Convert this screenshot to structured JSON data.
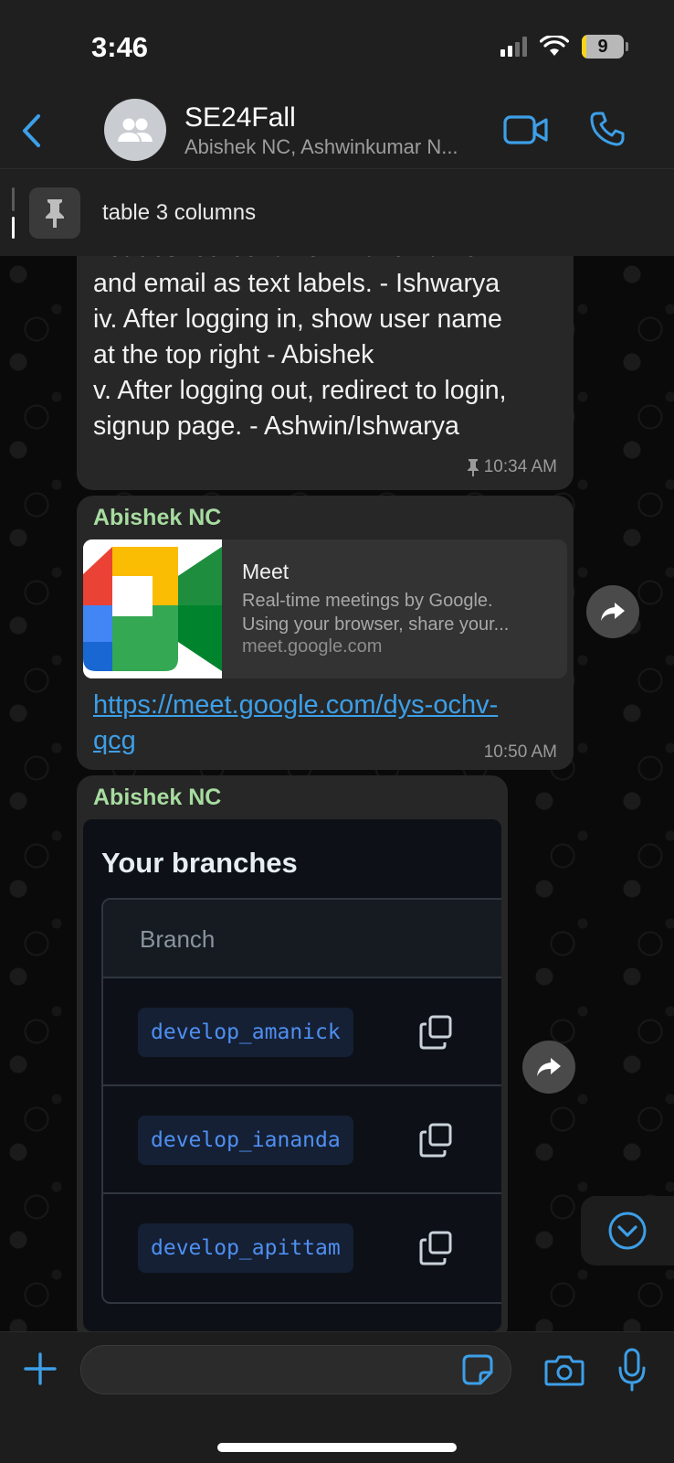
{
  "status_bar": {
    "time": "3:46",
    "battery_level": "9"
  },
  "header": {
    "title": "SE24Fall",
    "subtitle": "Abishek NC, Ashwinkumar N...",
    "accent": "#3d9fe8"
  },
  "pinned": {
    "text": "table 3 columns"
  },
  "messages": {
    "m1": {
      "lines": [
        "not desired behavior. Make name",
        "and email as text labels. - Ishwarya",
        "iv. After logging in, show user name",
        "at the top right - Abishek",
        "v. After logging out, redirect to login,",
        "signup page. - Ashwin/Ishwarya"
      ],
      "time": "10:34 AM",
      "pinned": true
    },
    "m2": {
      "sender": "Abishek NC",
      "link_title": "Meet",
      "link_desc_1": "Real-time meetings by Google.",
      "link_desc_2": "Using your browser, share your...",
      "link_domain": "meet.google.com",
      "url_1": "https://meet.google.com/dys-ochv-",
      "url_2": "qcg",
      "time": "10:50 AM"
    },
    "m3": {
      "sender": "Abishek NC",
      "image": {
        "title": "Your branches",
        "column_header": "Branch",
        "branches": [
          "develop_amanick",
          "develop_iananda",
          "develop_apittam"
        ]
      }
    }
  },
  "composer": {
    "input_value": "",
    "input_placeholder": ""
  },
  "colors": {
    "sender_name": "#a7dca0",
    "bubble": "#272727",
    "link": "#3d9fe8"
  }
}
